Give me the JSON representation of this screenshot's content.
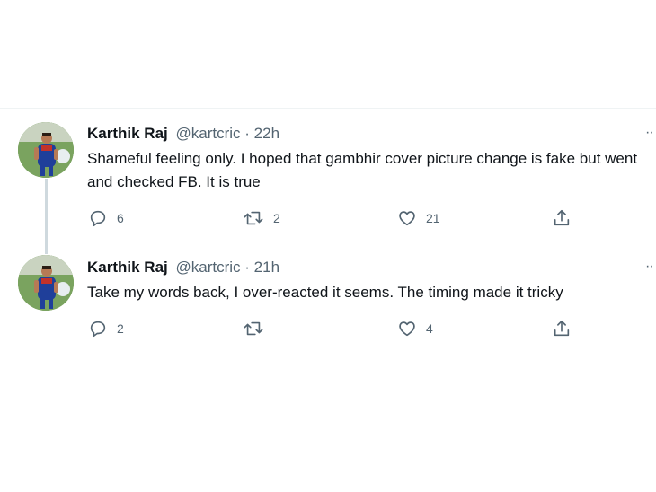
{
  "tweets": [
    {
      "author_name": "Karthik Raj",
      "handle": "@kartcric",
      "separator": "·",
      "time": "22h",
      "text": "Shameful feeling only. I hoped that gambhir cover picture change is fake but went and checked FB. It is true",
      "reply_count": "6",
      "retweet_count": "2",
      "like_count": "21",
      "more_label": "··",
      "avatar_icon": "player-avatar",
      "actions_icons": [
        "reply-icon",
        "retweet-icon",
        "like-icon",
        "share-icon"
      ]
    },
    {
      "author_name": "Karthik Raj",
      "handle": "@kartcric",
      "separator": "·",
      "time": "21h",
      "text": "Take my words back, I over-reacted it seems. The timing made it tricky",
      "reply_count": "2",
      "retweet_count": "",
      "like_count": "4",
      "more_label": "··",
      "avatar_icon": "player-avatar",
      "actions_icons": [
        "reply-icon",
        "retweet-icon",
        "like-icon",
        "share-icon"
      ]
    }
  ],
  "colors": {
    "text": "#0f1419",
    "secondary": "#536471",
    "thread_line": "#cfd9de",
    "divider": "#eff3f4"
  }
}
